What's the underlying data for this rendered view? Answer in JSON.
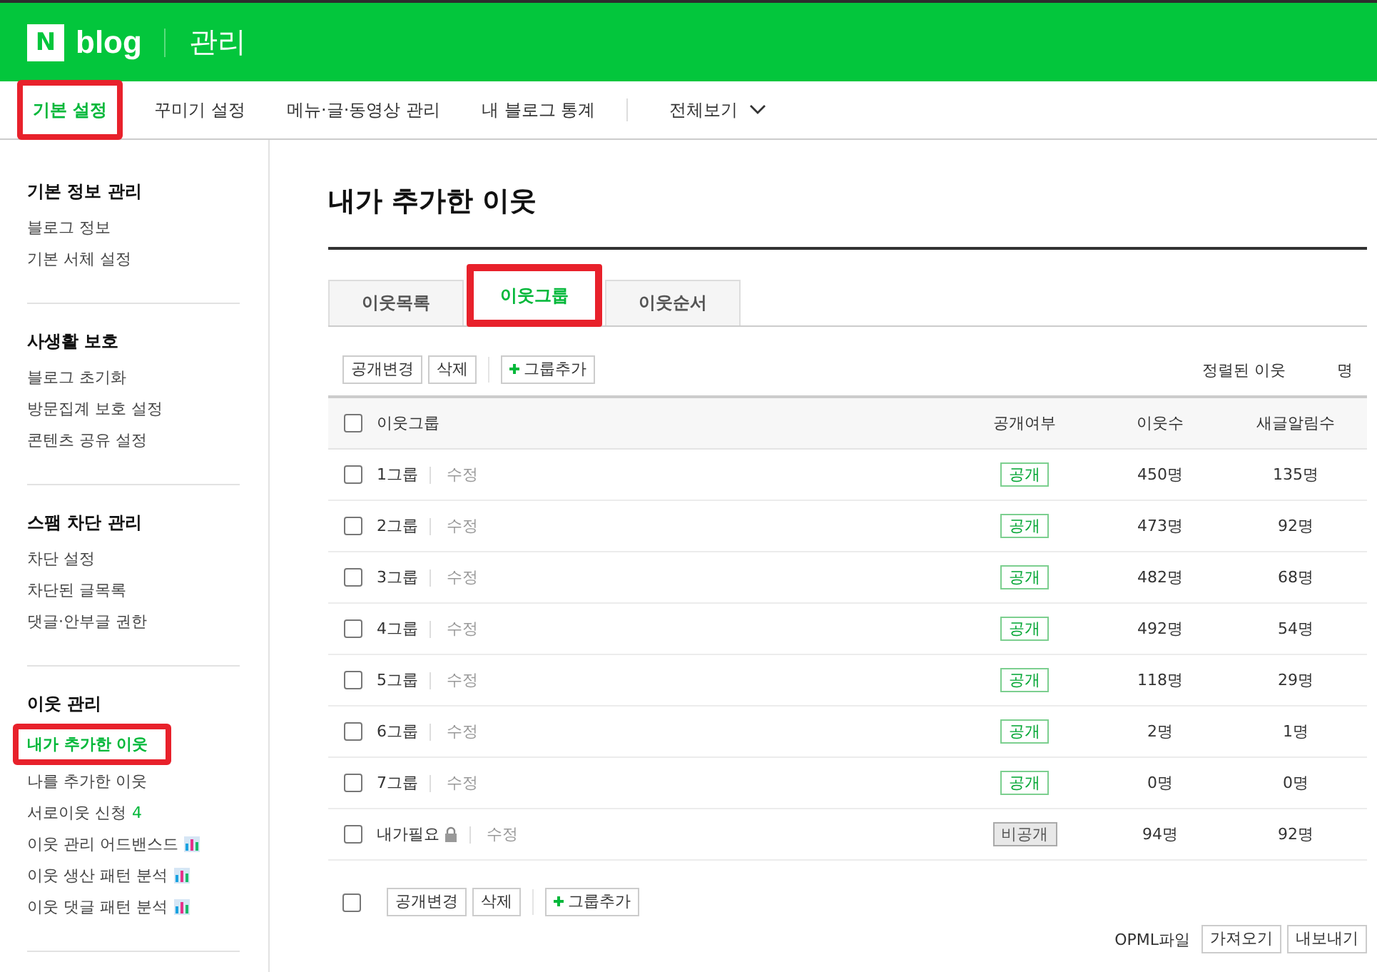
{
  "header": {
    "logo_letter": "N",
    "logo_word": "blog",
    "title": "관리"
  },
  "nav": [
    {
      "label": "기본 설정",
      "selected": true,
      "highlighted": true
    },
    {
      "label": "꾸미기 설정",
      "selected": false,
      "highlighted": false
    },
    {
      "label": "메뉴·글·동영상 관리",
      "selected": false,
      "highlighted": false
    },
    {
      "label": "내 블로그 통계",
      "selected": false,
      "highlighted": false
    }
  ],
  "nav_more": {
    "label": "전체보기"
  },
  "sidebar": [
    {
      "title": "기본 정보 관리",
      "items": [
        {
          "label": "블로그 정보",
          "selected": false,
          "highlighted": false
        },
        {
          "label": "기본 서체 설정",
          "selected": false,
          "highlighted": false
        }
      ]
    },
    {
      "title": "사생활 보호",
      "items": [
        {
          "label": "블로그 초기화",
          "selected": false,
          "highlighted": false
        },
        {
          "label": "방문집계 보호 설정",
          "selected": false,
          "highlighted": false
        },
        {
          "label": "콘텐츠 공유 설정",
          "selected": false,
          "highlighted": false
        }
      ]
    },
    {
      "title": "스팸 차단 관리",
      "items": [
        {
          "label": "차단 설정",
          "selected": false,
          "highlighted": false
        },
        {
          "label": "차단된 글목록",
          "selected": false,
          "highlighted": false
        },
        {
          "label": "댓글·안부글 권한",
          "selected": false,
          "highlighted": false
        }
      ]
    },
    {
      "title": "이웃 관리",
      "items": [
        {
          "label": "내가 추가한 이웃",
          "selected": true,
          "highlighted": true
        },
        {
          "label": "나를 추가한 이웃",
          "selected": false,
          "highlighted": false
        },
        {
          "label": "서로이웃 신청",
          "badge": "4",
          "selected": false,
          "highlighted": false
        },
        {
          "label": "이웃 관리 어드밴스드",
          "chart_icon": true,
          "selected": false,
          "highlighted": false
        },
        {
          "label": "이웃 생산 패턴 분석",
          "chart_icon": true,
          "selected": false,
          "highlighted": false
        },
        {
          "label": "이웃 댓글 패턴 분석",
          "chart_icon": true,
          "selected": false,
          "highlighted": false
        }
      ]
    }
  ],
  "page_title": "내가 추가한 이웃",
  "tabs": [
    {
      "label": "이웃목록",
      "selected": false,
      "highlighted": false
    },
    {
      "label": "이웃그룹",
      "selected": true,
      "highlighted": true
    },
    {
      "label": "이웃순서",
      "selected": false,
      "highlighted": false
    }
  ],
  "toolbar": {
    "buttons": [
      "공개변경",
      "삭제"
    ],
    "add_button": "그룹추가",
    "sort_label": "정렬된 이웃",
    "sort_unit": "명"
  },
  "table": {
    "select_all_checked": false,
    "columns": [
      "이웃그룹",
      "공개여부",
      "이웃수",
      "새글알림수"
    ],
    "rows": [
      {
        "name": "1그룹",
        "edit": "수정",
        "visibility": "공개",
        "public": true,
        "locked": false,
        "neighbors": "450명",
        "alerts": "135명",
        "checked": false
      },
      {
        "name": "2그룹",
        "edit": "수정",
        "visibility": "공개",
        "public": true,
        "locked": false,
        "neighbors": "473명",
        "alerts": "92명",
        "checked": false
      },
      {
        "name": "3그룹",
        "edit": "수정",
        "visibility": "공개",
        "public": true,
        "locked": false,
        "neighbors": "482명",
        "alerts": "68명",
        "checked": false
      },
      {
        "name": "4그룹",
        "edit": "수정",
        "visibility": "공개",
        "public": true,
        "locked": false,
        "neighbors": "492명",
        "alerts": "54명",
        "checked": false
      },
      {
        "name": "5그룹",
        "edit": "수정",
        "visibility": "공개",
        "public": true,
        "locked": false,
        "neighbors": "118명",
        "alerts": "29명",
        "checked": false
      },
      {
        "name": "6그룹",
        "edit": "수정",
        "visibility": "공개",
        "public": true,
        "locked": false,
        "neighbors": "2명",
        "alerts": "1명",
        "checked": false
      },
      {
        "name": "7그룹",
        "edit": "수정",
        "visibility": "공개",
        "public": true,
        "locked": false,
        "neighbors": "0명",
        "alerts": "0명",
        "checked": false
      },
      {
        "name": "내가필요",
        "edit": "수정",
        "visibility": "비공개",
        "public": false,
        "locked": true,
        "neighbors": "94명",
        "alerts": "92명",
        "checked": false
      }
    ]
  },
  "bottom_toolbar": {
    "select_all_checked": false,
    "buttons": [
      "공개변경",
      "삭제"
    ],
    "add_button": "그룹추가"
  },
  "opml": {
    "label": "OPML파일",
    "buttons": [
      "가져오기",
      "내보내기"
    ]
  }
}
